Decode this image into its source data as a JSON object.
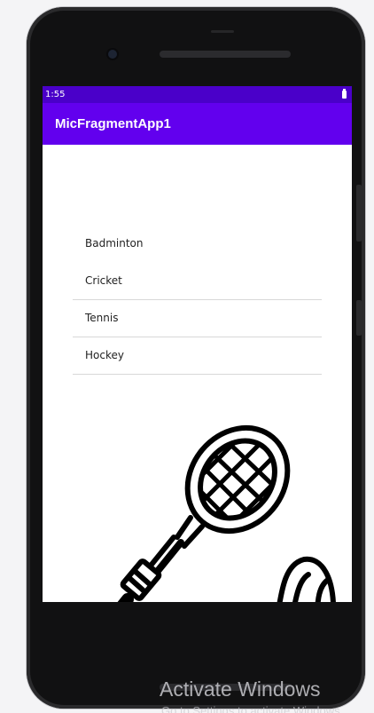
{
  "status_bar": {
    "time": "1:55",
    "battery_icon": "battery-icon"
  },
  "app_bar": {
    "title": "MicFragmentApp1"
  },
  "sports": [
    {
      "label": "Badminton"
    },
    {
      "label": "Cricket"
    },
    {
      "label": "Tennis"
    },
    {
      "label": "Hockey"
    }
  ],
  "illustration": {
    "icon": "badminton-racket-shuttlecock-icon"
  },
  "watermark": {
    "title": "Activate Windows",
    "subtitle": "Go to Settings to activate Windows."
  },
  "colors": {
    "status_bar": "#4a00c9",
    "app_bar": "#6200ee"
  }
}
